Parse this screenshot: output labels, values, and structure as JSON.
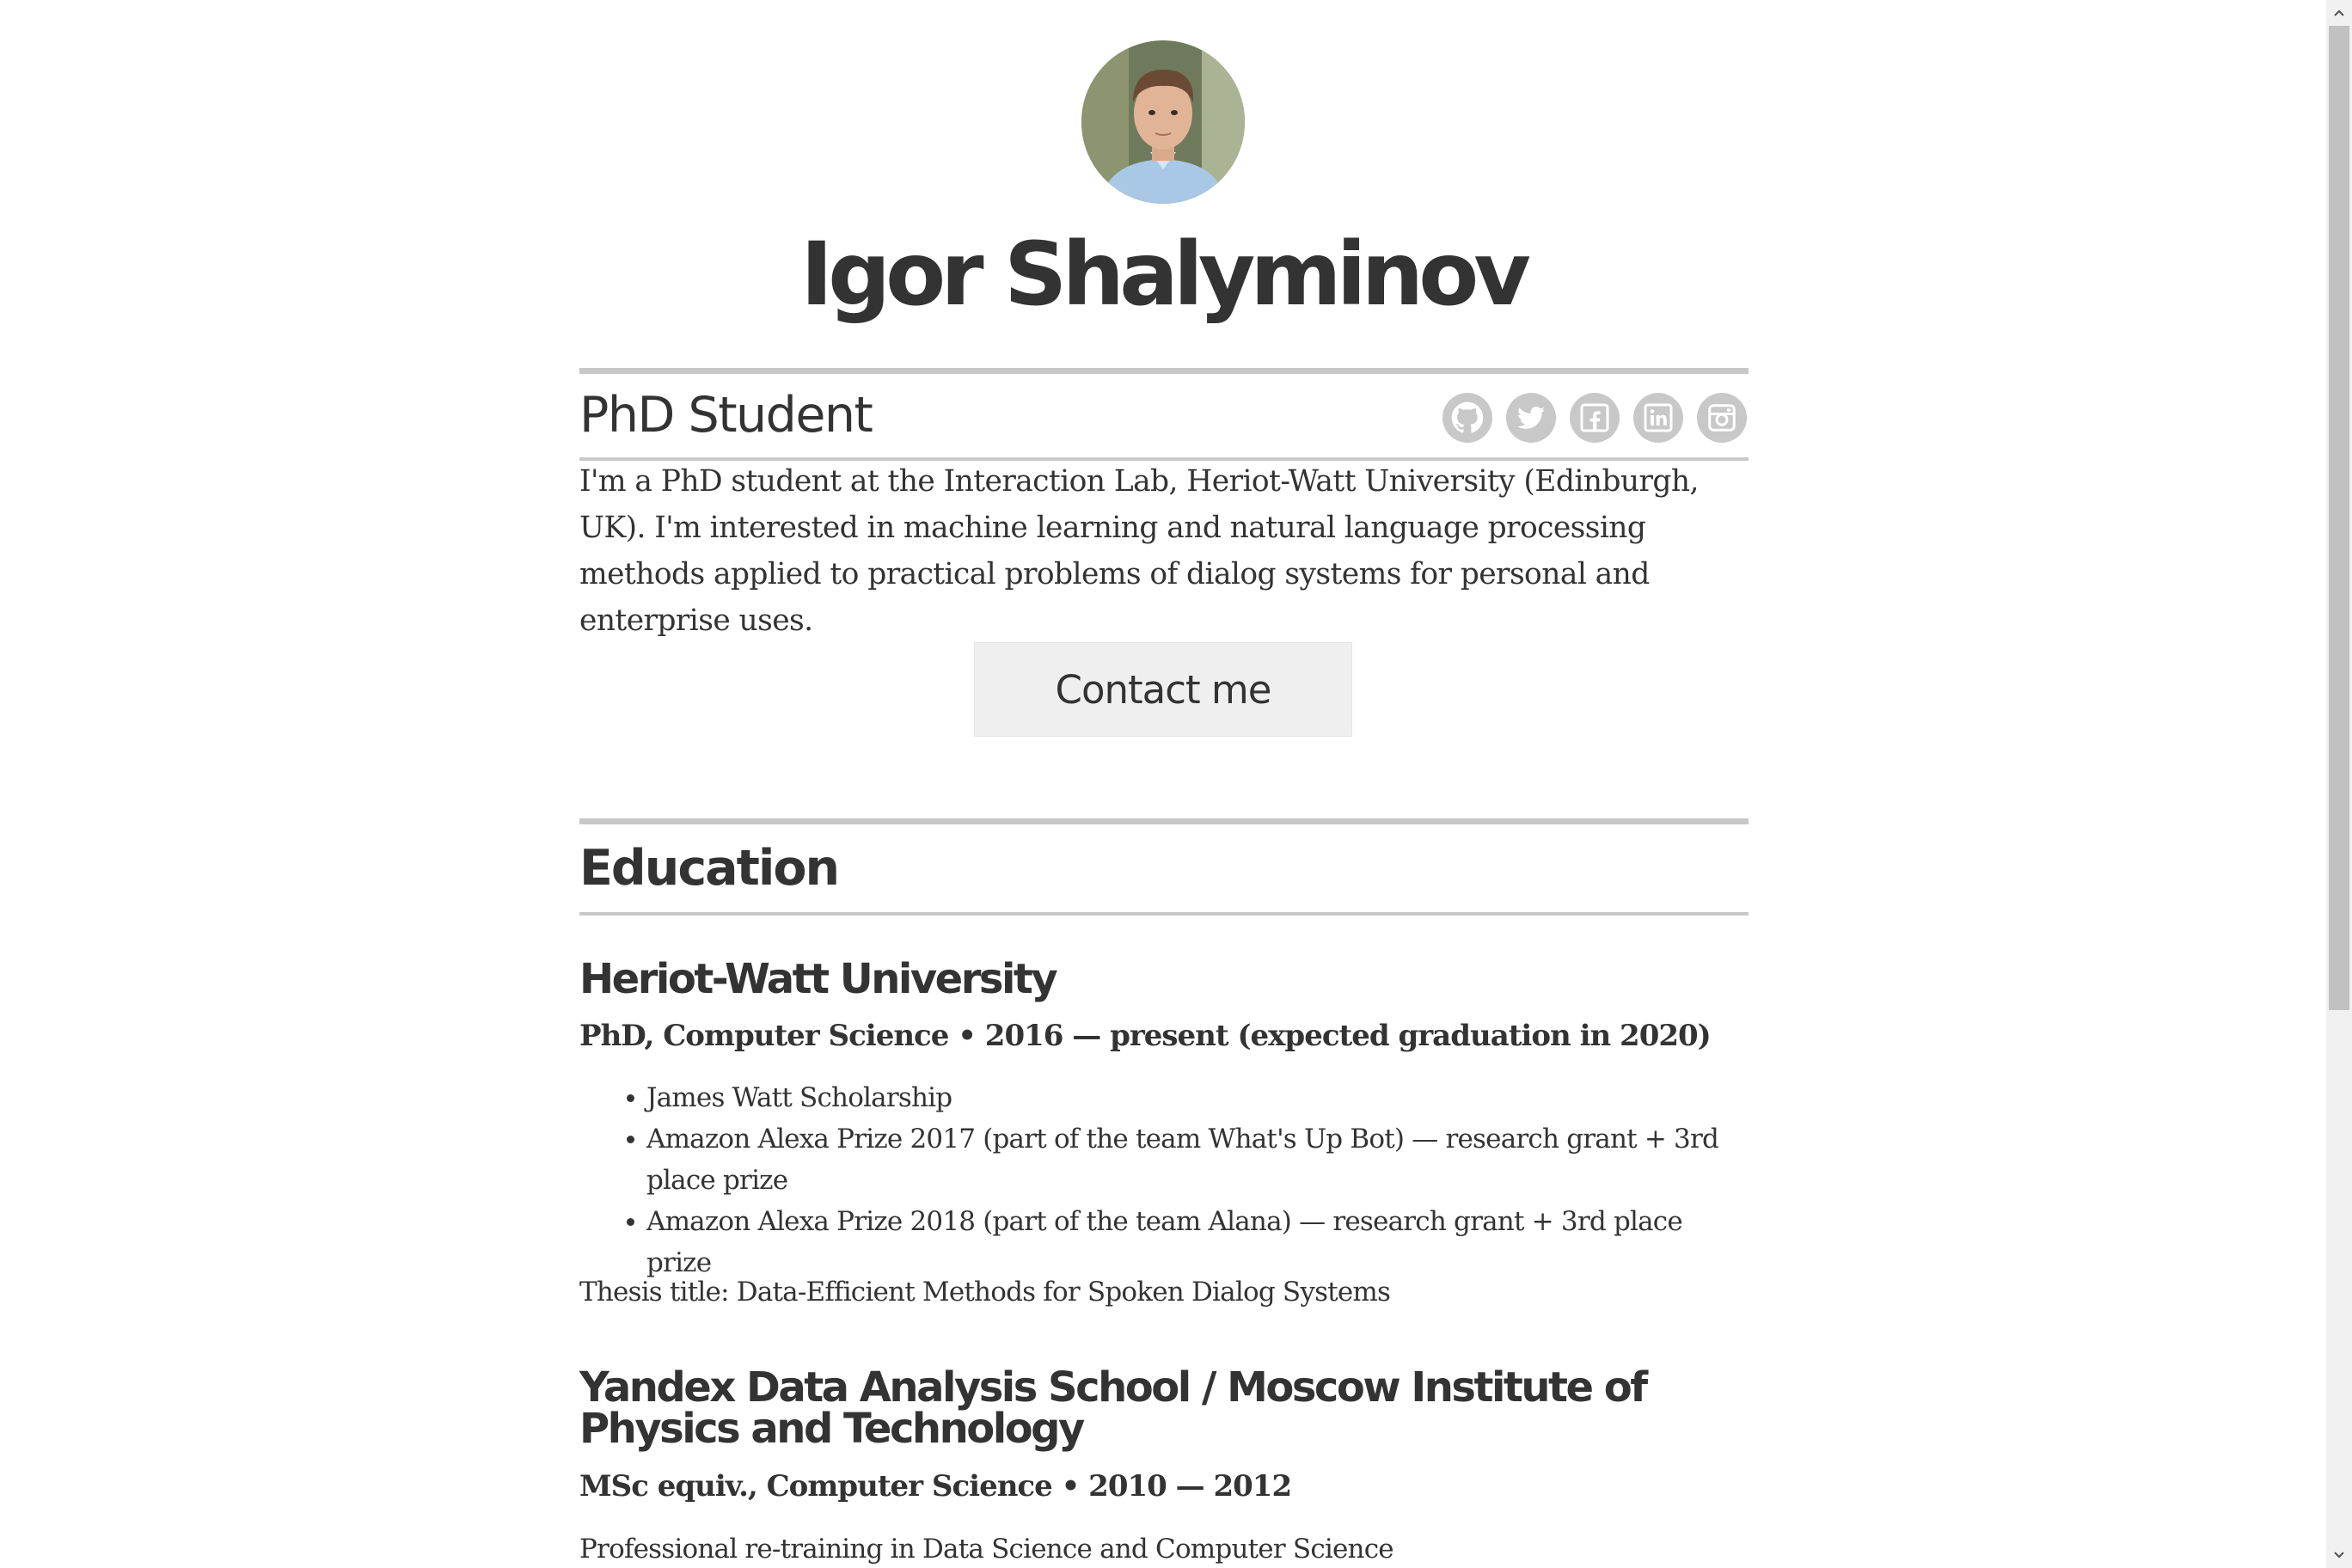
{
  "profile": {
    "name": "Igor Shalyminov",
    "title": "PhD Student",
    "bio": "I'm a PhD student at the Interaction Lab, Heriot-Watt University (Edinburgh, UK). I'm interested in machine learning and natural language processing methods applied to practical problems of dialog systems for personal and enterprise uses.",
    "avatar_alt": "Igor Shalyminov"
  },
  "social": [
    {
      "icon": "github-icon",
      "label": "GitHub"
    },
    {
      "icon": "twitter-icon",
      "label": "Twitter"
    },
    {
      "icon": "facebook-icon",
      "label": "Facebook"
    },
    {
      "icon": "linkedin-icon",
      "label": "LinkedIn"
    },
    {
      "icon": "instagram-icon",
      "label": "Instagram"
    }
  ],
  "contact": {
    "label": "Contact me"
  },
  "education": {
    "heading": "Education",
    "entries": [
      {
        "institution": "Heriot-Watt University",
        "degree": "PhD, Computer Science • 2016 — present (expected graduation in 2020)",
        "awards": [
          "James Watt Scholarship",
          "Amazon Alexa Prize 2017 (part of the team What's Up Bot) — research grant + 3rd place prize",
          "Amazon Alexa Prize 2018 (part of the team Alana) — research grant + 3rd place prize"
        ],
        "note": "Thesis title: Data-Efficient Methods for Spoken Dialog Systems"
      },
      {
        "institution": "Yandex Data Analysis School / Moscow Institute of Physics and Technology",
        "degree": "MSc equiv., Computer Science • 2010 — 2012",
        "note": "Professional re-training in Data Science and Computer Science"
      }
    ]
  },
  "colors": {
    "text": "#333333",
    "rule": "#c8c8c8",
    "button_bg": "#efefef",
    "icon_bg": "#c8c8c8"
  }
}
